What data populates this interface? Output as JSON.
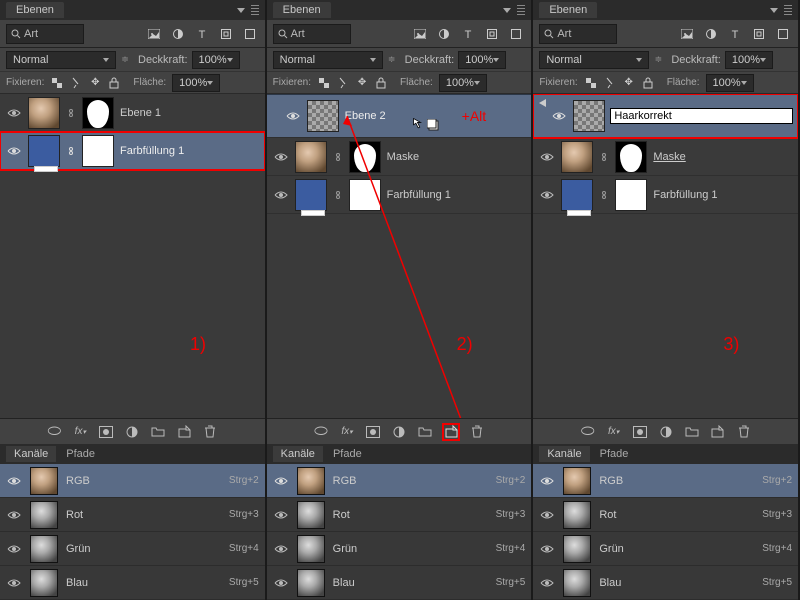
{
  "panel_title": "Ebenen",
  "search_label": "Art",
  "blend_mode": "Normal",
  "opacity_label": "Deckkraft:",
  "opacity_value": "100%",
  "lock_label": "Fixieren:",
  "fill_label": "Fläche:",
  "fill_value": "100%",
  "channels_title": "Kanäle",
  "paths_title": "Pfade",
  "channels": [
    {
      "name": "RGB",
      "shortcut": "Strg+2"
    },
    {
      "name": "Rot",
      "shortcut": "Strg+3"
    },
    {
      "name": "Grün",
      "shortcut": "Strg+4"
    },
    {
      "name": "Blau",
      "shortcut": "Strg+5"
    }
  ],
  "col1": {
    "step_num": "1)",
    "layers": [
      {
        "name": "Ebene 1"
      },
      {
        "name": "Farbfüllung 1"
      }
    ]
  },
  "col2": {
    "step_num": "2)",
    "alt_label": "+Alt",
    "layers": [
      {
        "name": "Ebene 2"
      },
      {
        "name": "Maske"
      },
      {
        "name": "Farbfüllung 1"
      }
    ]
  },
  "col3": {
    "step_num": "3)",
    "rename_value": "Haarkorrekt",
    "layers": [
      {
        "name": "Haarkorrekt"
      },
      {
        "name": "Maske"
      },
      {
        "name": "Farbfüllung 1"
      }
    ]
  }
}
